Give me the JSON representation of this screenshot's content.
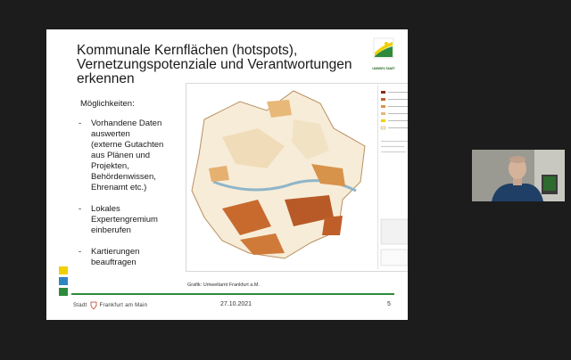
{
  "slide": {
    "title": "Kommunale Kernflächen (hotspots), Vernetzungspotenziale und Verantwortungen erkennen",
    "logo_text": "UMWELTAMT",
    "options_title": "Möglichkeiten:",
    "bullets": [
      {
        "dash": "-",
        "text": "Vorhandene Daten\nauswerten\n(externe Gutachten\naus Plänen und\nProjekten,\nBehördenwissen,\nEhrenamt etc.)"
      },
      {
        "dash": "-",
        "text": "Lokales\nExpertengremium\neinberufen"
      },
      {
        "dash": "-",
        "text": "Kartierungen\nbeauftragen"
      }
    ],
    "caption": "Grafik: Umweltamt Frankfurt a.M.",
    "footer_city": "Stadt",
    "footer_city2": "Frankfurt am Main",
    "footer_date": "27.10.2021",
    "footer_page": "5",
    "square_colors": [
      "#f0d000",
      "#2e86c1",
      "#2e8b3c"
    ],
    "accent_color": "#2e8b3c"
  },
  "video": {
    "participant_icon": "webcam-participant"
  }
}
